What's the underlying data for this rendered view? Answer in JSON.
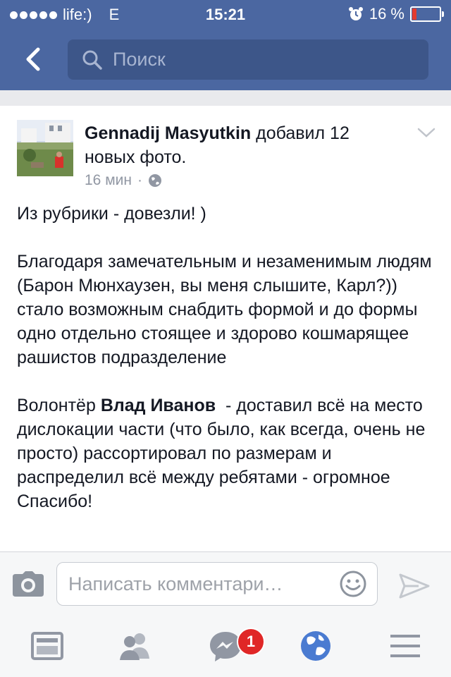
{
  "status_bar": {
    "carrier": "life:)",
    "network": "E",
    "time": "15:21",
    "battery_percent": "16 %",
    "battery_level": 0.16
  },
  "nav": {
    "search_placeholder": "Поиск"
  },
  "post": {
    "author": "Gennadij Masyutkin",
    "action": "добавил 12 новых фото.",
    "time_ago": "16 мин",
    "separator": "·",
    "paragraphs": {
      "p1": "Из рубрики - довезли! )",
      "p2": "Благодаря замечательным и незаменимым людям (Барон Мюнхаузен, вы меня слышите, Карл?)) стало возможным снабдить формой и до формы одно отдельно стоящее и здорово кошмарящее рашистов подразделение",
      "p3_prefix": "Волонтёр ",
      "p3_name": "Влад Иванов",
      "p3_rest": "  - доставил всё на место дислокации части (что было, как всегда, очень не просто) рассортировал по размерам и распределил всё между ребятами - огромное Спасибо!"
    }
  },
  "comment": {
    "placeholder": "Написать комментари…"
  },
  "tabs": {
    "messages_badge": "1"
  },
  "colors": {
    "header": "#4b67a1",
    "search_field": "#3d5689",
    "badge": "#e02727",
    "globe_active": "#4a7bd1"
  },
  "icons": [
    "back-chevron-icon",
    "search-icon",
    "chevron-down-icon",
    "globe-icon",
    "camera-icon",
    "smiley-icon",
    "send-icon",
    "news-feed-icon",
    "friends-icon",
    "messenger-icon",
    "notifications-globe-icon",
    "menu-icon"
  ]
}
